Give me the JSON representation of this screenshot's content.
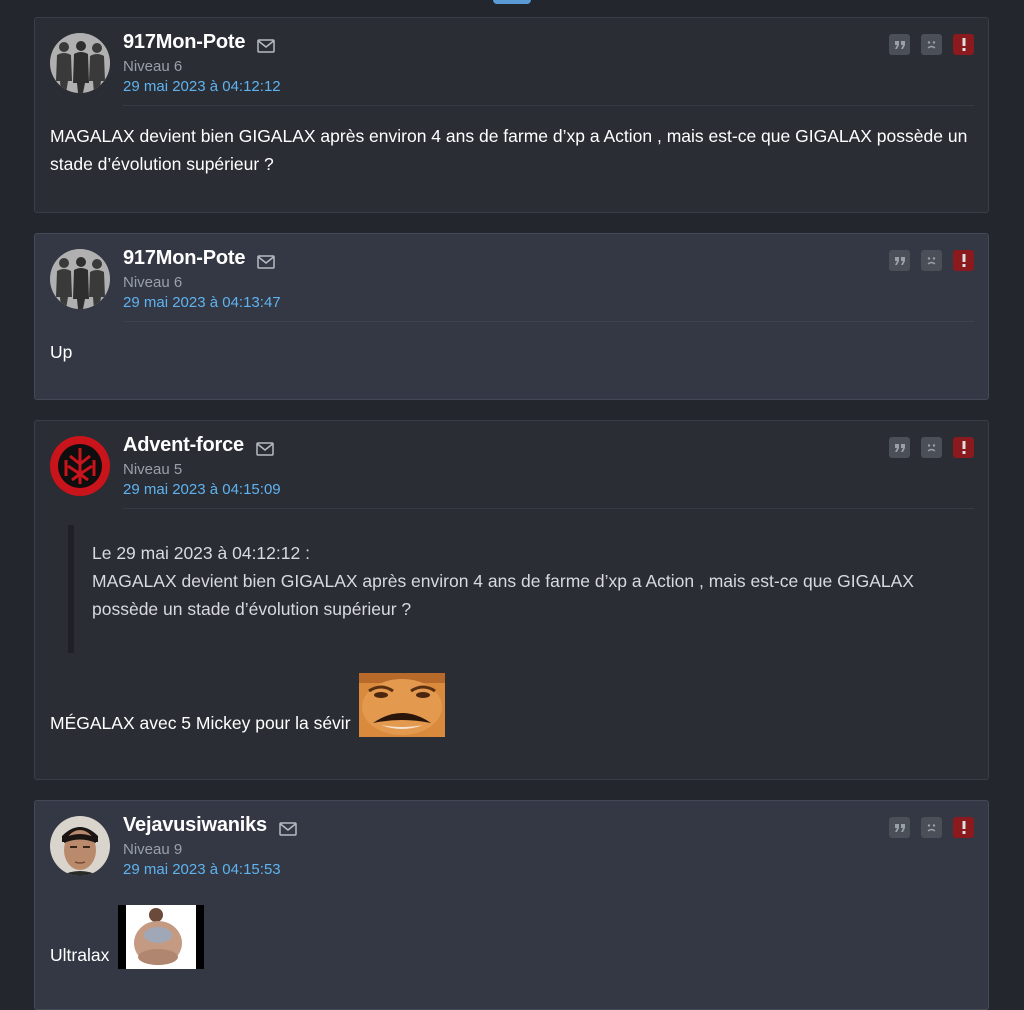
{
  "posts": [
    {
      "author": "917Mon-Pote",
      "level": "Niveau 6",
      "date": "29 mai 2023 à 04:12:12",
      "text": "MAGALAX devient bien GIGALAX après environ 4 ans de farme d’xp a Action , mais est-ce que GIGALAX possède un stade d’évolution supérieur ?"
    },
    {
      "author": "917Mon-Pote",
      "level": "Niveau 6",
      "date": "29 mai 2023 à 04:13:47",
      "text": "Up"
    },
    {
      "author": "Advent-force",
      "level": "Niveau 5",
      "date": "29 mai 2023 à 04:15:09",
      "quote_header": "Le 29 mai 2023 à 04:12:12 :",
      "quote_text": "MAGALAX devient bien GIGALAX après environ 4 ans de farme d’xp a Action , mais est-ce que GIGALAX possède un stade d’évolution supérieur ?",
      "text": "MÉGALAX avec 5 Mickey pour la sévir"
    },
    {
      "author": "Vejavusiwaniks",
      "level": "Niveau 9",
      "date": "29 mai 2023 à 04:15:53",
      "text": "Ultralax"
    }
  ],
  "icons": {
    "mail": "mail-icon",
    "quote": "quote-icon",
    "frown": "frown-icon",
    "report": "report-icon"
  },
  "colors": {
    "background": "#23262d",
    "card": "#2a2d34",
    "card_alt": "#333844",
    "date": "#5fb3f0",
    "report": "#8a1a1d"
  }
}
